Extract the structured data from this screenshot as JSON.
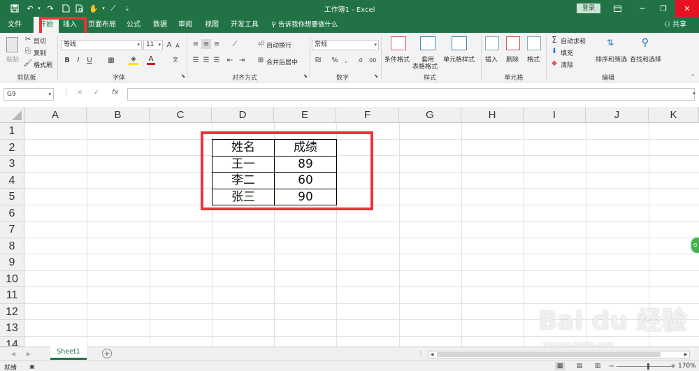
{
  "titlebar": {
    "title": "工作簿1  -  Excel",
    "login": "登录",
    "icons": [
      "save-icon",
      "undo-icon",
      "redo-icon",
      "new-doc-icon",
      "print-preview-icon",
      "touch-mode-icon",
      "draw-icon",
      "customize-icon",
      "ribbon-display-icon",
      "minimize-icon",
      "restore-icon",
      "close-icon"
    ]
  },
  "tabs": [
    {
      "label": "文件"
    },
    {
      "label": "开始"
    },
    {
      "label": "插入"
    },
    {
      "label": "页面布局"
    },
    {
      "label": "公式"
    },
    {
      "label": "数据"
    },
    {
      "label": "审阅"
    },
    {
      "label": "视图"
    },
    {
      "label": "开发工具"
    }
  ],
  "tell_me": "告诉我你想要做什么",
  "share": "共享",
  "ribbon": {
    "clipboard": {
      "paste": "粘贴",
      "cut": "剪切",
      "copy": "复制",
      "format_painter": "格式刷",
      "label": "剪贴板"
    },
    "font": {
      "name": "等线",
      "size": "11",
      "bold": "B",
      "italic": "I",
      "underline": "U",
      "font_color_glyph": "A",
      "label": "字体"
    },
    "alignment": {
      "wrap": "自动换行",
      "merge": "合并后居中",
      "label": "对齐方式"
    },
    "number": {
      "format": "常规",
      "percent": "%",
      "comma": ",",
      "label": "数字"
    },
    "styles": {
      "conditional": "条件格式",
      "table_1": "套用",
      "table_2": "表格格式",
      "cell_styles": "单元格样式",
      "label": "样式"
    },
    "cells": {
      "insert": "插入",
      "delete": "删除",
      "format": "格式",
      "label": "单元格"
    },
    "editing": {
      "autosum": "自动求和",
      "fill": "填充",
      "clear": "清除",
      "sort": "排序和筛选",
      "find": "查找和选择",
      "label": "编辑"
    }
  },
  "formula_bar": {
    "name_box": "G9",
    "cancel": "×",
    "enter": "✓",
    "fx": "fx",
    "value": ""
  },
  "columns": [
    "A",
    "B",
    "C",
    "D",
    "E",
    "F",
    "G",
    "H",
    "I",
    "J",
    "K"
  ],
  "rows": [
    "1",
    "2",
    "3",
    "4",
    "5",
    "6",
    "7",
    "8",
    "9",
    "10",
    "11",
    "12",
    "13",
    "14"
  ],
  "table": {
    "header": [
      "姓名",
      "成绩"
    ],
    "rows": [
      [
        "王一",
        "89"
      ],
      [
        "李二",
        "60"
      ],
      [
        "张三",
        "90"
      ]
    ]
  },
  "sheet": {
    "tab": "Sheet1",
    "add": "+"
  },
  "status": {
    "ready": "就绪",
    "zoom": "170%"
  },
  "colors": {
    "brand": "#217346",
    "highlight": "#e8353a"
  },
  "watermark": {
    "logo": "Bai du 经验",
    "url": "jingyan.baidu.com"
  }
}
